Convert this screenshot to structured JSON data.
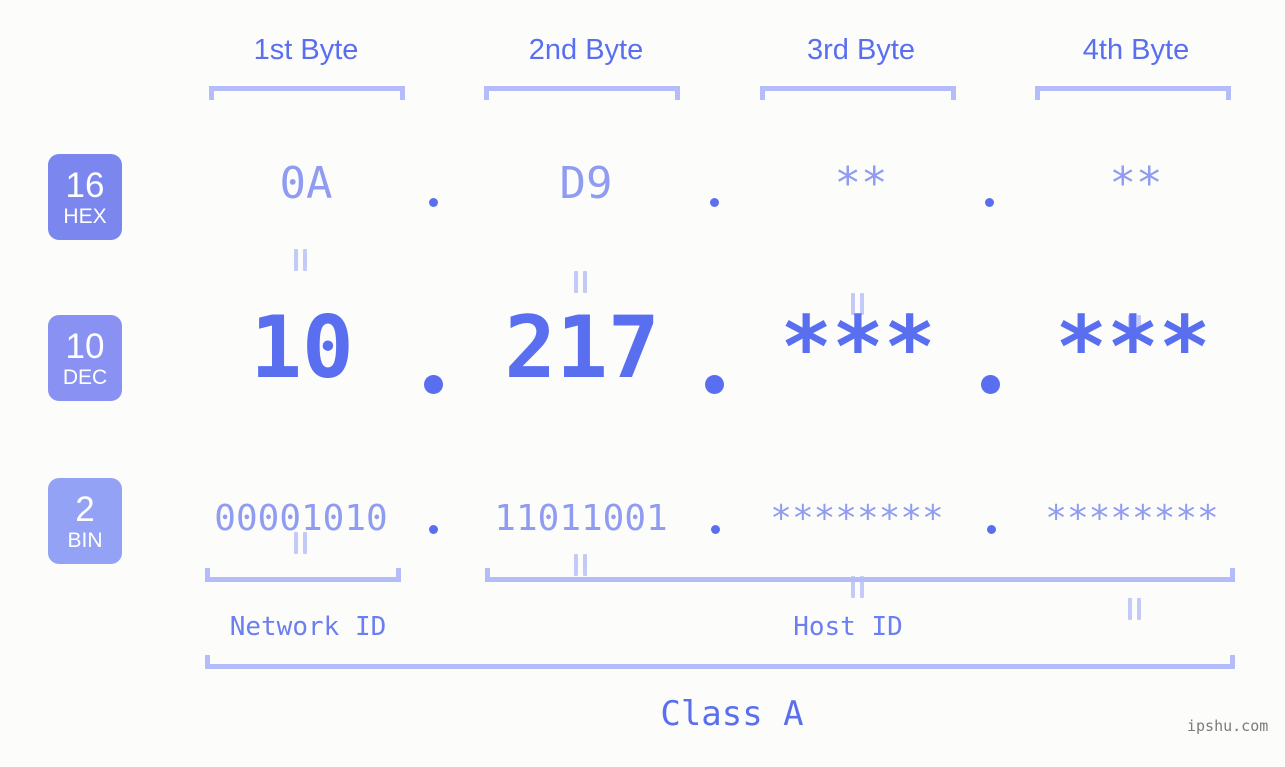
{
  "background_color": "#fcfdfa",
  "accent_color": "#5a6ff0",
  "muted_accent_color": "#909cf2",
  "bracket_color": "#b4bdfa",
  "headers": {
    "byte1": "1st Byte",
    "byte2": "2nd Byte",
    "byte3": "3rd Byte",
    "byte4": "4th Byte"
  },
  "bases": [
    {
      "number": "16",
      "label": "HEX",
      "badge_color": "#7b86ef"
    },
    {
      "number": "10",
      "label": "DEC",
      "badge_color": "#8992f2"
    },
    {
      "number": "2",
      "label": "BIN",
      "badge_color": "#93a2f5"
    }
  ],
  "rows": {
    "hex": {
      "base_number": "16",
      "base_label": "HEX",
      "values": [
        "0A",
        "D9",
        "**",
        "**"
      ],
      "separator": "."
    },
    "dec": {
      "base_number": "10",
      "base_label": "DEC",
      "values": [
        "10",
        "217",
        "***",
        "***"
      ],
      "separator": "."
    },
    "bin": {
      "base_number": "2",
      "base_label": "BIN",
      "values": [
        "00001010",
        "11011001",
        "********",
        "********"
      ],
      "separator": "."
    }
  },
  "equality_marks": [
    "=",
    "=",
    "=",
    "=",
    "=",
    "=",
    "=",
    "="
  ],
  "sections": {
    "network_id": "Network ID",
    "host_id": "Host ID",
    "class": "Class A"
  },
  "watermark": "ipshu.com",
  "chart_data": {
    "type": "table",
    "title": "IP Address Byte Breakdown - Class A",
    "columns": [
      "1st Byte",
      "2nd Byte",
      "3rd Byte",
      "4th Byte"
    ],
    "rows": [
      {
        "base": "16 HEX",
        "cells": [
          "0A",
          "D9",
          "**",
          "**"
        ]
      },
      {
        "base": "10 DEC",
        "cells": [
          "10",
          "217",
          "***",
          "***"
        ]
      },
      {
        "base": "2 BIN",
        "cells": [
          "00001010",
          "11011001",
          "********",
          "********"
        ]
      }
    ],
    "annotations": {
      "network_id_span": [
        "1st Byte"
      ],
      "host_id_span": [
        "2nd Byte",
        "3rd Byte",
        "4th Byte"
      ],
      "class": "Class A"
    }
  }
}
